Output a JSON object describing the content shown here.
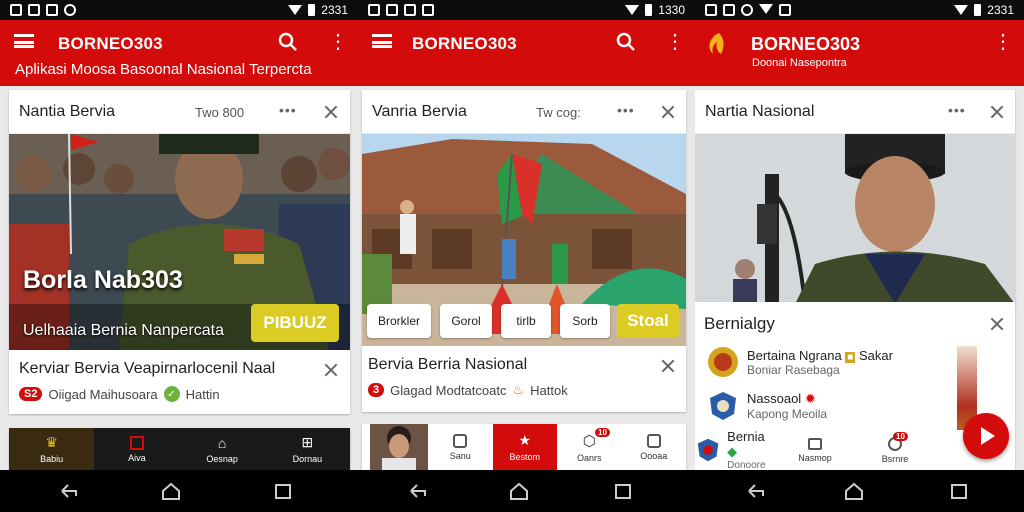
{
  "status": {
    "time1": "2331",
    "time2": "1330",
    "time3": "2331"
  },
  "app": {
    "brand": "BORNEO303",
    "tagline1": "Aplikasi Moosa  Basoonal Nasional Terpercta",
    "tagline3": "Doonai Nasepontra"
  },
  "screen1": {
    "card_title": "Nantia Bervia",
    "card_time": "Two 800",
    "hero_title": "Borla Nab303",
    "hero_caption": "Uelhaaia Bernia Nanpercata",
    "hero_button": "PIBUUZ",
    "row_title": "Kerviar  Bervia  Veapirnarlocenil  Naal",
    "row_badge": "S2",
    "row_meta": "Oiigad Maihusoara",
    "row_meta2": "Hattin",
    "nav": [
      "Babiu",
      "Aiva",
      "Oesnap",
      "Dornau"
    ]
  },
  "screen2": {
    "card_title": "Vanria Bervia",
    "card_time": "Tw cog:",
    "chips": [
      "Brorkler",
      "Gorol",
      "tirlb",
      "Sorb"
    ],
    "chip_cta": "Stoal",
    "row_title": "Bervia Berria Nasional",
    "row_badge": "3",
    "row_meta": "Glagad Modtatcoatc",
    "row_meta2": "Hattok",
    "nav": [
      "Sanu",
      "Bestom",
      "Oanrs",
      "Oooaa"
    ],
    "nav_badge": "10"
  },
  "screen3": {
    "card_title": "Nartia Nasional",
    "panel_title": "Bernialgy",
    "list": [
      {
        "name": "Bertaina Ngrana",
        "sub": "Boniar Rasebaga",
        "tag": "Sakar"
      },
      {
        "name": "Nassoaol",
        "sub": "Kapong Meoila",
        "tag": ""
      },
      {
        "name": "Bernia",
        "sub": "Donoore",
        "tag": ""
      }
    ],
    "nav": [
      "Nasmop",
      "Bsrnre"
    ],
    "nav_badge": "10"
  },
  "colors": {
    "brand_red": "#d30b0b",
    "accent_yellow": "#dccb22"
  }
}
